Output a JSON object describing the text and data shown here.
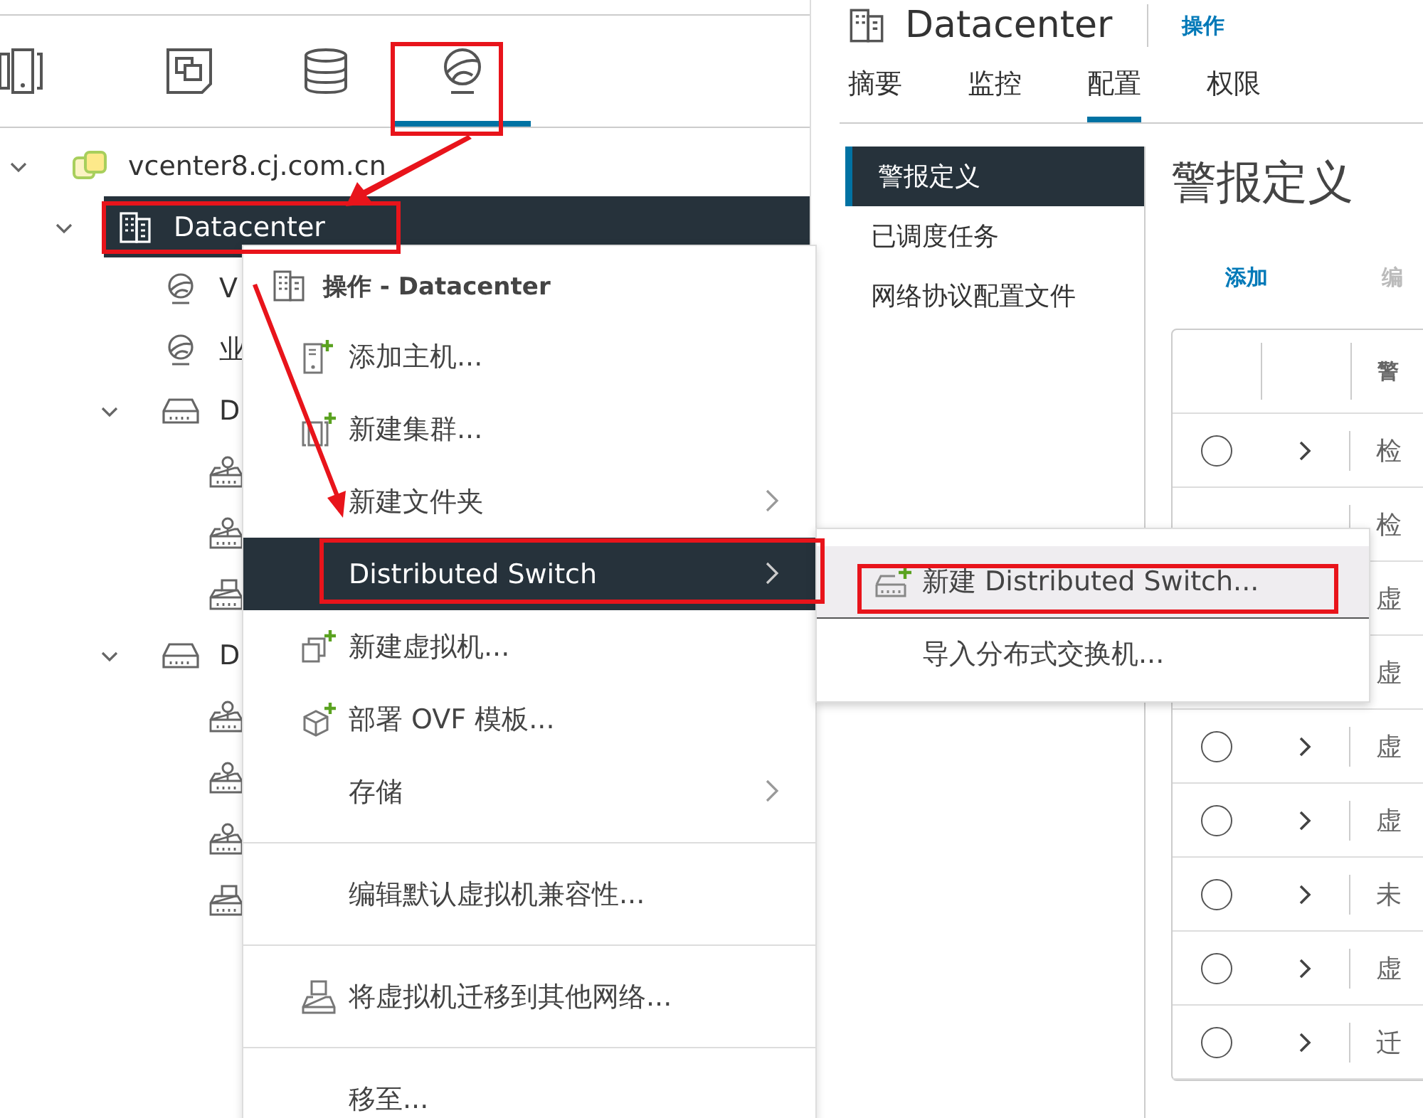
{
  "view_tabs": [
    {
      "kind": "hosts",
      "selected": false
    },
    {
      "kind": "vms",
      "selected": false
    },
    {
      "kind": "storage",
      "selected": false
    },
    {
      "kind": "network",
      "selected": true
    }
  ],
  "tree": [
    {
      "label": "vcenter8.cj.com.cn",
      "kind": "vcenter",
      "expanded": true,
      "selected": false,
      "children": [
        {
          "label": "Datacenter",
          "kind": "datacenter",
          "expanded": true,
          "selected": true,
          "children": [
            {
              "label": "V",
              "kind": "network",
              "selected": false
            },
            {
              "label": "业",
              "kind": "network",
              "selected": false
            },
            {
              "label": "D",
              "kind": "switch",
              "expanded": true,
              "selected": false,
              "children": [
                {
                  "kind": "portgroup",
                  "selected": false
                },
                {
                  "kind": "portgroup",
                  "selected": false
                },
                {
                  "kind": "uplink",
                  "selected": false
                }
              ]
            },
            {
              "label": "D",
              "kind": "switch",
              "expanded": true,
              "selected": false,
              "children": [
                {
                  "kind": "portgroup",
                  "selected": false
                },
                {
                  "kind": "portgroup",
                  "selected": false
                },
                {
                  "kind": "portgroup",
                  "selected": false
                },
                {
                  "kind": "uplink",
                  "selected": false
                }
              ]
            }
          ]
        }
      ]
    }
  ],
  "context_menu": {
    "title": "操作 - Datacenter",
    "groups": [
      [
        {
          "label": "添加主机...",
          "submenu": false,
          "highlighted": false
        },
        {
          "label": "新建集群...",
          "submenu": false,
          "highlighted": false
        },
        {
          "label": "新建文件夹",
          "submenu": true,
          "highlighted": false
        },
        {
          "label": "Distributed Switch",
          "submenu": true,
          "highlighted": true
        },
        {
          "label": "新建虚拟机...",
          "submenu": false,
          "highlighted": false
        },
        {
          "label": "部署 OVF 模板...",
          "submenu": false,
          "highlighted": false
        },
        {
          "label": "存储",
          "submenu": true,
          "highlighted": false
        }
      ],
      [
        {
          "label": "编辑默认虚拟机兼容性...",
          "submenu": false,
          "highlighted": false
        }
      ],
      [
        {
          "label": "将虚拟机迁移到其他网络...",
          "submenu": false,
          "highlighted": false
        }
      ],
      [
        {
          "label": "移至...",
          "submenu": false,
          "highlighted": false
        }
      ]
    ]
  },
  "submenu": {
    "groups": [
      [
        {
          "label": "新建 Distributed Switch...",
          "highlighted": true
        }
      ],
      [
        {
          "label": "导入分布式交换机...",
          "highlighted": false
        }
      ]
    ]
  },
  "object_header": {
    "title": "Datacenter",
    "actions": "操作"
  },
  "tabs": [
    {
      "label": "摘要",
      "selected": false
    },
    {
      "label": "监控",
      "selected": false
    },
    {
      "label": "配置",
      "selected": true
    },
    {
      "label": "权限",
      "selected": false
    }
  ],
  "config_nav": [
    {
      "label": "警报定义",
      "selected": true
    },
    {
      "label": "已调度任务",
      "selected": false
    },
    {
      "label": "网络协议配置文件",
      "selected": false
    }
  ],
  "content": {
    "heading": "警报定义",
    "toolbar": [
      {
        "label": "添加",
        "disabled": false
      },
      {
        "label": "编",
        "disabled": true
      }
    ],
    "table": {
      "columns": [
        "警"
      ],
      "rows": [
        {
          "column_1": "检",
          "selected": false
        },
        {
          "column_1": "检"
        },
        {
          "column_1": "虚"
        },
        {
          "column_1": "虚"
        },
        {
          "column_1": "虚",
          "selected": false
        },
        {
          "column_1": "虚",
          "selected": false
        },
        {
          "column_1": "未",
          "selected": false
        },
        {
          "column_1": "虚",
          "selected": false
        },
        {
          "column_1": "迁",
          "selected": false
        }
      ]
    }
  }
}
